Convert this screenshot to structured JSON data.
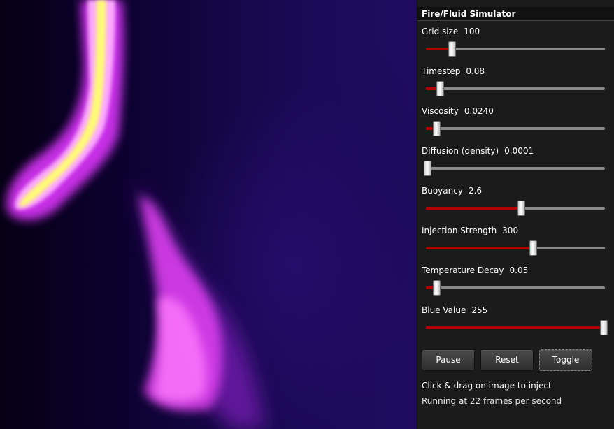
{
  "panel": {
    "title": "Fire/Fluid Simulator"
  },
  "sliders": [
    {
      "label": "Grid size",
      "value_text": "100",
      "level": 0.14
    },
    {
      "label": "Timestep",
      "value_text": "0.08",
      "level": 0.07
    },
    {
      "label": "Viscosity",
      "value_text": "0.0240",
      "level": 0.05
    },
    {
      "label": "Diffusion (density)",
      "value_text": "0.0001",
      "level": 0.0
    },
    {
      "label": "Buoyancy",
      "value_text": "2.6",
      "level": 0.53
    },
    {
      "label": "Injection Strength",
      "value_text": "300",
      "level": 0.6
    },
    {
      "label": "Temperature Decay",
      "value_text": "0.05",
      "level": 0.05
    },
    {
      "label": "Blue Value",
      "value_text": "255",
      "level": 1.0
    }
  ],
  "buttons": {
    "pause": "Pause",
    "reset": "Reset",
    "toggle": "Toggle"
  },
  "info": {
    "hint": "Click & drag on image to inject",
    "status": "Running at 22 frames per second"
  },
  "colors": {
    "slider_fill": "#b00000",
    "panel_bg": "#1b1b1b",
    "flame_core": "#ffff40",
    "flame_glow": "#ff40ff"
  }
}
